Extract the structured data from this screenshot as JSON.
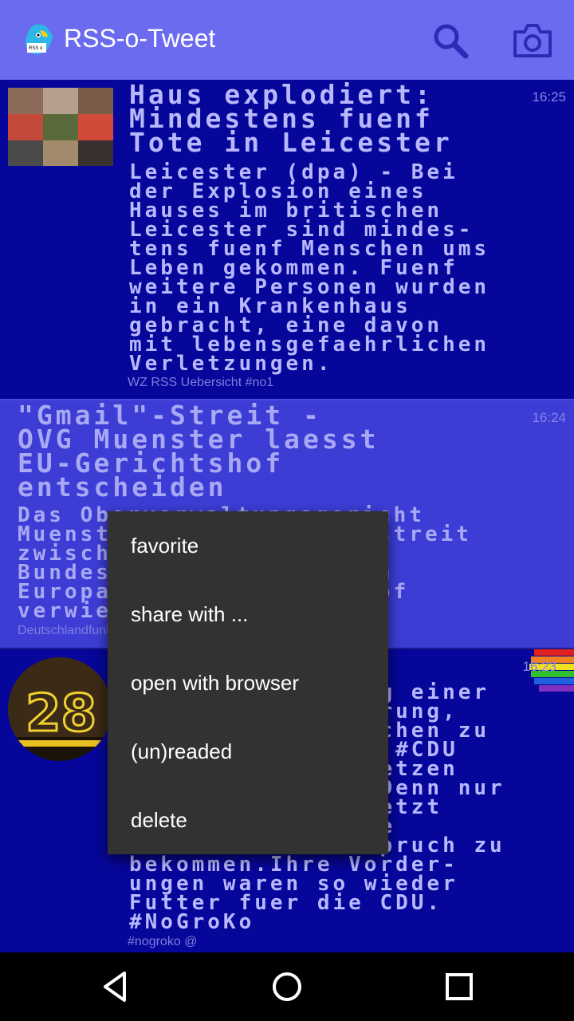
{
  "app": {
    "title": "RSS-o-Tweet",
    "logo_icon": "rss-parrot-logo-icon",
    "actions": [
      {
        "name": "search",
        "icon": "search-icon"
      },
      {
        "name": "camera",
        "icon": "camera-icon"
      }
    ]
  },
  "feed": {
    "items": [
      {
        "title": "Haus explodiert: Mindestens fuenf Tote in Leicester",
        "title_lines": [
          "Haus explodiert:",
          "Mindestens fuenf",
          "Tote in Leicester"
        ],
        "body_lines": [
          "Leicester (dpa) - Bei",
          "der Explosion eines",
          "Hauses im britischen",
          "Leicester sind mindes-",
          "tens fuenf Menschen ums",
          "Leben gekommen. Fuenf",
          "weitere Personen wurden",
          "in ein Krankenhaus",
          "gebracht, eine davon",
          "mit lebensgefaehrlichen",
          "Verletzungen."
        ],
        "time": "16:25",
        "source": "WZ RSS Uebersicht #no1",
        "thumbnail": "news-photo-thumbnail"
      },
      {
        "title_lines": [
          "\"Gmail\"-Streit -",
          "OVG Muenster laesst",
          "EU-Gerichtshof",
          "entscheiden"
        ],
        "body_lines": [
          "Das Oberverwaltungsgericht",
          "Muenster hat den Rechtsstreit",
          "zwischen Google und der",
          "Bundesnetzagentur an den",
          "Europaeischen Gerichtshof",
          "verwiesen."
        ],
        "time": "16:24",
        "source": "Deutschlandfunk"
      },
      {
        "body_lines": [
          "Eine Verweigerung einer",
          "Minderheitsregierung,",
          "den Weg freizumachen zu",
          "lassen, wird die #CDU",
          "ihr Programm umsetzen",
          "lassen muessen. Denn nur",
          "so hat die SPD jetzt",
          "die Chance, seine",
          "Themen einen Anspruch zu",
          "bekommen.Ihre Vorder-",
          "ungen waren so wieder",
          "Futter fuer die CDU.",
          "#NoGroKo"
        ],
        "time": "16:23",
        "source": "#nogroko @",
        "avatar": "number-28-avatar",
        "badge_icon": "rainbow-stripes-icon"
      }
    ]
  },
  "context_menu": {
    "items": [
      "favorite",
      "share with ...",
      "open with browser",
      "(un)readed",
      "delete"
    ]
  },
  "navigation": {
    "buttons": [
      {
        "name": "back",
        "icon": "back-triangle-icon"
      },
      {
        "name": "home",
        "icon": "home-circle-icon"
      },
      {
        "name": "recents",
        "icon": "recents-square-icon"
      }
    ]
  },
  "colors": {
    "appbar": "#6b6bf0",
    "item_dark": "#06069a",
    "item_highlight": "#3d3dd6",
    "text": "#b8b8ff",
    "menu_bg": "#323232"
  }
}
